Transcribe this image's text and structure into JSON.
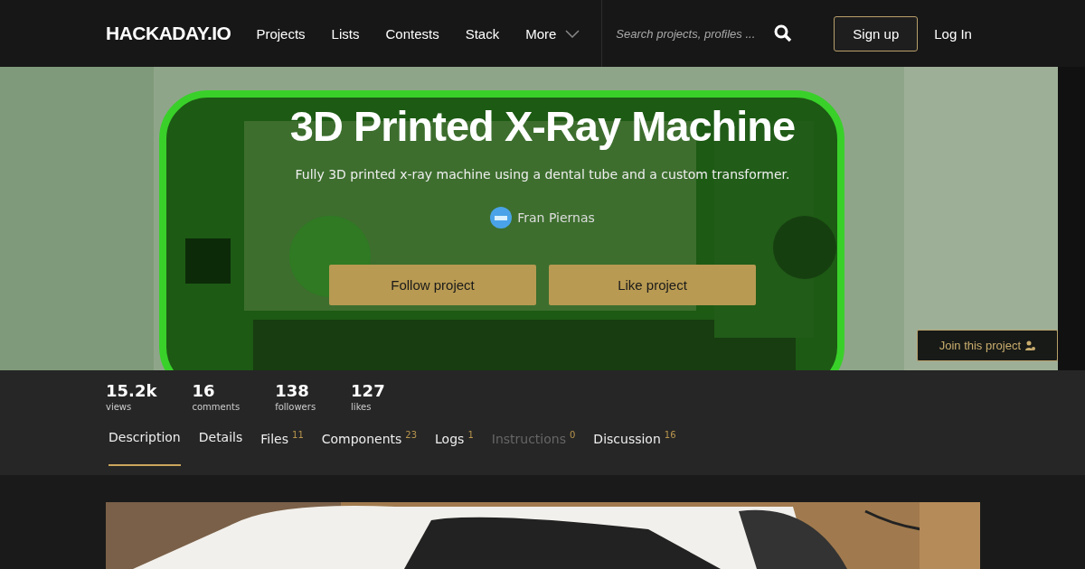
{
  "header": {
    "logo": "HACKADAY.IO",
    "nav": [
      "Projects",
      "Lists",
      "Contests",
      "Stack"
    ],
    "more": "More",
    "search": {
      "placeholder": "Search projects, profiles ..."
    },
    "signup": "Sign up",
    "login": "Log In"
  },
  "hero": {
    "title": "3D Printed X-Ray Machine",
    "summary": "Fully 3D printed x-ray machine using a dental tube and a custom transformer.",
    "author": "Fran Piernas",
    "buttons": [
      "Follow project",
      "Like project"
    ],
    "join": "Join this project"
  },
  "stats": [
    {
      "value": "15.2k",
      "label": "views"
    },
    {
      "value": "16",
      "label": "comments"
    },
    {
      "value": "138",
      "label": "followers"
    },
    {
      "value": "127",
      "label": "likes"
    }
  ],
  "tabs": [
    {
      "label": "Description",
      "selected": true,
      "disabled": false
    },
    {
      "label": "Details",
      "selected": false,
      "disabled": false
    },
    {
      "label": "Files",
      "count": "11",
      "selected": false,
      "disabled": false
    },
    {
      "label": "Components",
      "count": "23",
      "selected": false,
      "disabled": false
    },
    {
      "label": "Logs",
      "count": "1",
      "selected": false,
      "disabled": false
    },
    {
      "label": "Instructions",
      "count": "0",
      "selected": false,
      "disabled": true
    },
    {
      "label": "Discussion",
      "count": "16",
      "selected": false,
      "disabled": false
    }
  ]
}
